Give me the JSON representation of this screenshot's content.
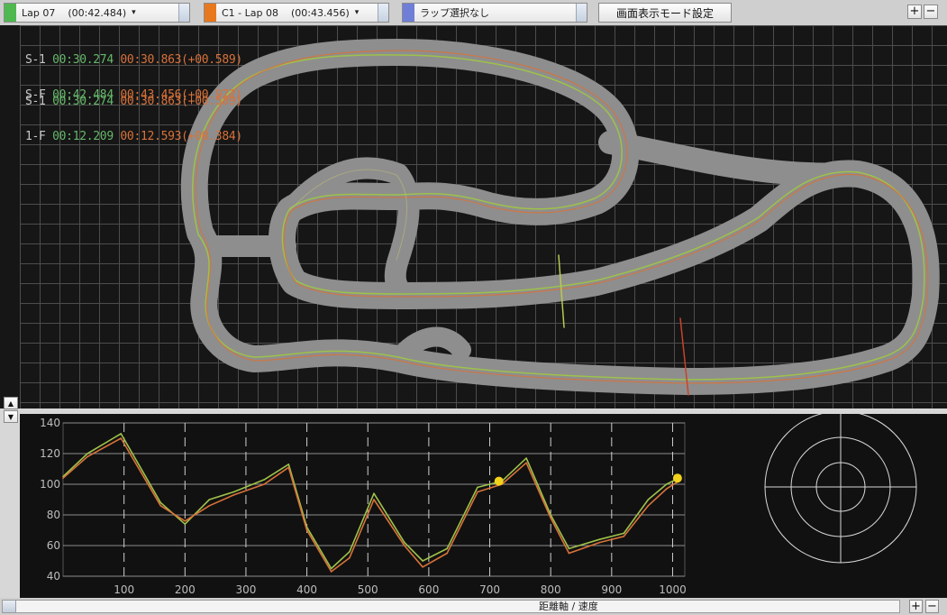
{
  "selectors": [
    {
      "label": "Lap 07    (00:42.484)",
      "color": "#4fb84f",
      "arrow": "▾"
    },
    {
      "label": "C1 - Lap 08    (00:43.456)",
      "color": "#e8781e",
      "arrow": "▾"
    },
    {
      "label": "ラップ選択なし",
      "color": "#6f7fd8",
      "arrow": ""
    }
  ],
  "display_mode_button": "画面表示モード設定",
  "zoom": {
    "plus": "+",
    "minus": "−"
  },
  "sections": [
    {
      "label": "S-1",
      "time_a": "00:30.274",
      "time_b": "00:30.863",
      "delta": "(+00.589)"
    },
    {
      "label": "S-F",
      "time_a": "00:42.484",
      "time_b": "00:43.456",
      "delta": "(+00.972)"
    },
    {
      "label": "S-1",
      "time_a": "00:30.274",
      "time_b": "00:30.863",
      "delta": "(+00.589)"
    },
    {
      "label": "1-F",
      "time_a": "00:12.209",
      "time_b": "00:12.593",
      "delta": "(+00.384)"
    }
  ],
  "scroll_arrows": {
    "up": "▲",
    "down": "▼",
    "left": "◂"
  },
  "axis_label": "距離軸 / 速度",
  "colors": {
    "lap_a": "#9ec24a",
    "lap_b": "#d8723a",
    "track": "#8e8e8e",
    "marker": "#f2d21b"
  },
  "chart_data": {
    "type": "line",
    "xlabel": "",
    "ylabel": "",
    "xlim": [
      0,
      1020
    ],
    "ylim": [
      40,
      140
    ],
    "x_ticks": [
      100,
      200,
      300,
      400,
      500,
      600,
      700,
      800,
      900,
      1000
    ],
    "y_ticks": [
      140,
      120,
      100,
      80,
      60,
      40
    ],
    "grid": true,
    "series": [
      {
        "color": "#9ec24a",
        "x": [
          0,
          40,
          95,
          160,
          200,
          240,
          280,
          330,
          370,
          400,
          440,
          470,
          510,
          560,
          590,
          630,
          680,
          720,
          760,
          800,
          830,
          880,
          920,
          960,
          990,
          1010
        ],
        "y": [
          105,
          120,
          133,
          88,
          74,
          90,
          95,
          103,
          113,
          72,
          45,
          56,
          94,
          62,
          50,
          58,
          98,
          102,
          117,
          80,
          58,
          64,
          68,
          90,
          100,
          104
        ]
      },
      {
        "color": "#d8723a",
        "x": [
          0,
          40,
          95,
          160,
          200,
          240,
          280,
          330,
          370,
          400,
          440,
          470,
          510,
          560,
          590,
          630,
          680,
          720,
          760,
          800,
          830,
          880,
          920,
          960,
          990,
          1010
        ],
        "y": [
          104,
          118,
          130,
          86,
          76,
          86,
          93,
          100,
          111,
          70,
          43,
          52,
          90,
          60,
          46,
          55,
          95,
          100,
          114,
          78,
          55,
          62,
          66,
          86,
          97,
          102
        ]
      }
    ],
    "markers": [
      {
        "x": 715,
        "y": 102
      },
      {
        "x": 1008,
        "y": 104
      }
    ]
  }
}
